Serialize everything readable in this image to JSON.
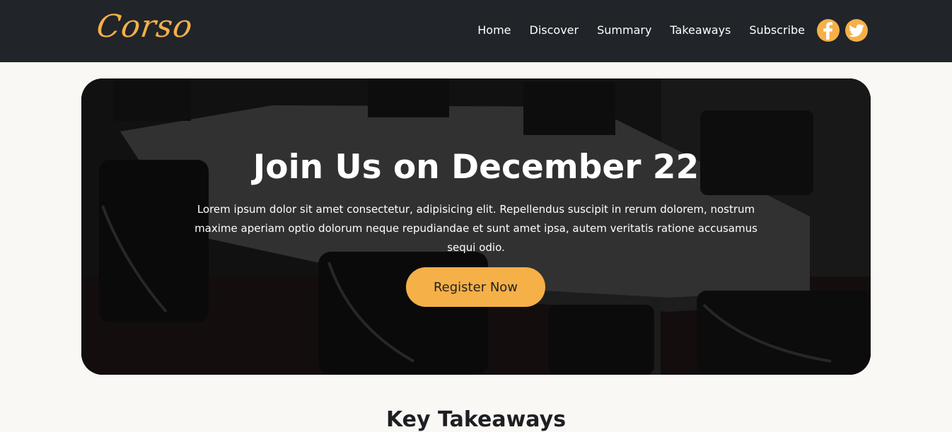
{
  "brand": {
    "logo_text": "Corso"
  },
  "nav": {
    "items": [
      {
        "label": "Home"
      },
      {
        "label": "Discover"
      },
      {
        "label": "Summary"
      },
      {
        "label": "Takeaways"
      },
      {
        "label": "Subscribe"
      }
    ]
  },
  "social": {
    "icons": [
      "facebook-icon",
      "twitter-icon"
    ]
  },
  "hero": {
    "title": "Join Us on December 22",
    "text": "Lorem ipsum dolor sit amet consectetur, adipisicing elit. Repellendus suscipit in rerum dolorem, nostrum maxime aperiam optio dolorum neque repudiandae et sunt amet ipsa, autem veritatis ratione accusamus sequi odio.",
    "button_label": "Register Now"
  },
  "sections": {
    "key_takeaways_title": "Key Takeaways"
  },
  "colors": {
    "accent": "#f5b047",
    "navbar_bg": "#212429",
    "page_bg": "#f9f8f4"
  }
}
